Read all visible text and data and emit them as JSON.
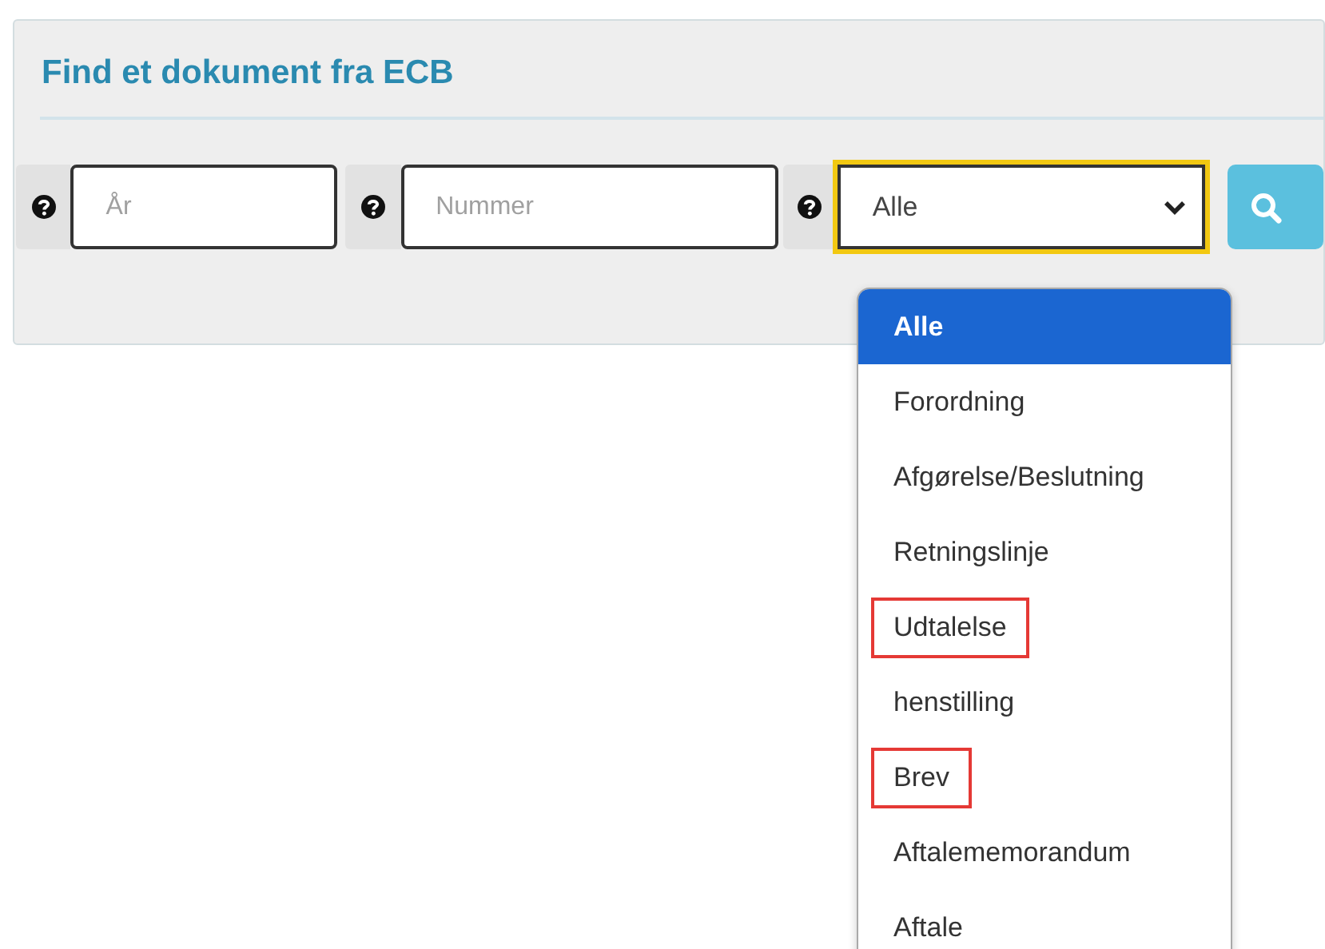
{
  "panel": {
    "title": "Find et dokument fra ECB"
  },
  "fields": [
    {
      "kind": "text",
      "placeholder": "År"
    },
    {
      "kind": "text",
      "placeholder": "Nummer"
    },
    {
      "kind": "select",
      "value": "Alle",
      "focused": true
    }
  ],
  "dropdown": {
    "options": [
      {
        "label": "Alle",
        "selected": true,
        "highlighted": false
      },
      {
        "label": "Forordning",
        "selected": false,
        "highlighted": false
      },
      {
        "label": "Afgørelse/Beslutning",
        "selected": false,
        "highlighted": false
      },
      {
        "label": "Retningslinje",
        "selected": false,
        "highlighted": false
      },
      {
        "label": "Udtalelse",
        "selected": false,
        "highlighted": true
      },
      {
        "label": "henstilling",
        "selected": false,
        "highlighted": false
      },
      {
        "label": "Brev",
        "selected": false,
        "highlighted": true
      },
      {
        "label": "Aftalememorandum",
        "selected": false,
        "highlighted": false
      },
      {
        "label": "Aftale",
        "selected": false,
        "highlighted": false
      }
    ]
  }
}
